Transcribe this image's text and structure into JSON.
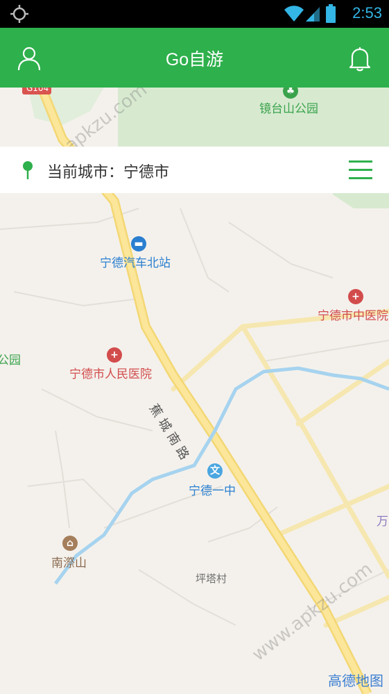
{
  "status_bar": {
    "time": "2:53"
  },
  "app_bar": {
    "title": "Go自游"
  },
  "city_bar": {
    "label": "当前城市：宁德市"
  },
  "map": {
    "road_badge": "G104",
    "road_name": "蕉城南路",
    "pois": {
      "jingtaishan_park": "镜台山公园",
      "bus_station": "宁德汽车北站",
      "tcm_hospital": "宁德市中医院",
      "park_left": "公园",
      "peoples_hospital": "宁德市人民医院",
      "no1_middle_school": "宁德一中",
      "nanqishan": "南漈山",
      "pingtacun": "坪塔村",
      "wan": "万"
    },
    "logo": "高德地图"
  },
  "watermarks": [
    "www.apkzu.com",
    "www.apkzu.com"
  ],
  "colors": {
    "brand_green": "#2eb04c",
    "status_bar": "#000000",
    "road_yellow": "#f5dc7a"
  }
}
